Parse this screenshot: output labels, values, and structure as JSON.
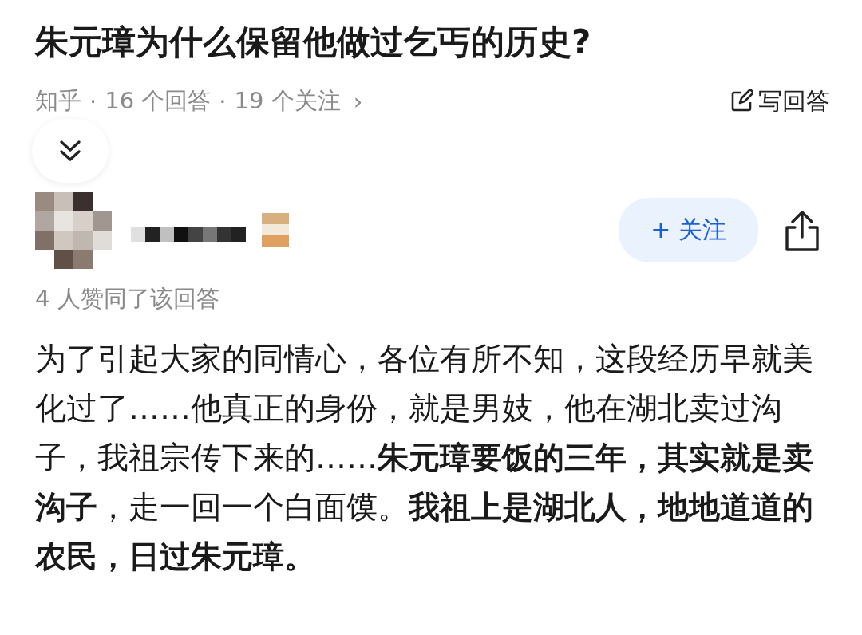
{
  "question": {
    "title": "朱元璋为什么保留他做过乞丐的历史?",
    "source": "知乎",
    "separators": [
      "·",
      "·"
    ],
    "answers": "16 个回答",
    "follows": "19 个关注",
    "more": "›",
    "write_button": "写回答"
  },
  "answer": {
    "follow_button": "+ 关注",
    "upvotes": "4 人赞同了该回答",
    "body": "为了引起大家的同情心，各位有所不知，这段经历早就美化过了……他真正的身份，就是男妓，他在湖北卖过沟子，我祖宗传下来的……**朱元璋要饭的三年，其实就是卖沟子**，走一回一个白面馍。**我祖上是湖北人，地地道道的农民，日过朱元璋。**"
  }
}
